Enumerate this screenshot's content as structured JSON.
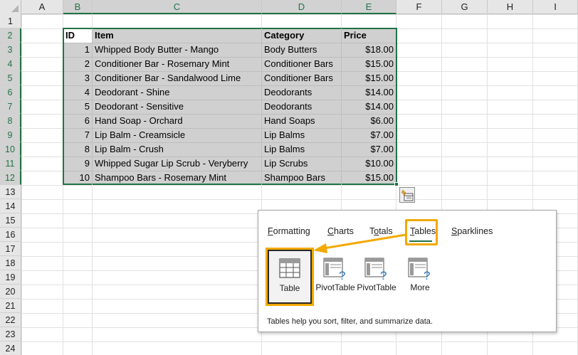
{
  "columns": [
    "A",
    "B",
    "C",
    "D",
    "E",
    "F",
    "G",
    "H",
    "I"
  ],
  "rows": [
    "1",
    "2",
    "3",
    "4",
    "5",
    "6",
    "7",
    "8",
    "9",
    "10",
    "11",
    "12",
    "13",
    "14",
    "15",
    "16",
    "17",
    "18",
    "19",
    "20",
    "21",
    "22",
    "23",
    "24"
  ],
  "table": {
    "headers": [
      "ID",
      "Item",
      "Category",
      "Price"
    ],
    "rows": [
      [
        "1",
        "Whipped Body Butter - Mango",
        "Body Butters",
        "$18.00"
      ],
      [
        "2",
        "Conditioner Bar - Rosemary Mint",
        "Conditioner Bars",
        "$15.00"
      ],
      [
        "3",
        "Conditioner Bar - Sandalwood Lime",
        "Conditioner Bars",
        "$15.00"
      ],
      [
        "4",
        "Deodorant - Shine",
        "Deodorants",
        "$14.00"
      ],
      [
        "5",
        "Deodorant - Sensitive",
        "Deodorants",
        "$14.00"
      ],
      [
        "6",
        "Hand Soap - Orchard",
        "Hand Soaps",
        "$6.00"
      ],
      [
        "7",
        "Lip Balm - Creamsicle",
        "Lip Balms",
        "$7.00"
      ],
      [
        "8",
        "Lip Balm - Crush",
        "Lip Balms",
        "$7.00"
      ],
      [
        "9",
        "Whipped Sugar Lip Scrub - Veryberry",
        "Lip Scrubs",
        "$10.00"
      ],
      [
        "10",
        "Shampoo Bars - Rosemary Mint",
        "Shampoo Bars",
        "$15.00"
      ]
    ]
  },
  "quick_analysis": {
    "tabs": [
      {
        "label": "Formatting",
        "accel": "F"
      },
      {
        "label": "Charts",
        "accel": "C"
      },
      {
        "label": "Totals",
        "accel": "O"
      },
      {
        "label": "Tables",
        "accel": "T",
        "selected": true
      },
      {
        "label": "Sparklines",
        "accel": "S"
      }
    ],
    "items": [
      {
        "label": "Table",
        "icon": "table-icon"
      },
      {
        "label": "PivotTable",
        "icon": "pivottable-icon"
      },
      {
        "label": "PivotTable",
        "icon": "pivottable-icon"
      },
      {
        "label": "More",
        "icon": "more-pivottables-icon"
      }
    ],
    "footer": "Tables help you sort, filter, and summarize data."
  },
  "colors": {
    "accent": "#217346",
    "highlight": "#f2a900",
    "selection": "#d0d0d0"
  }
}
